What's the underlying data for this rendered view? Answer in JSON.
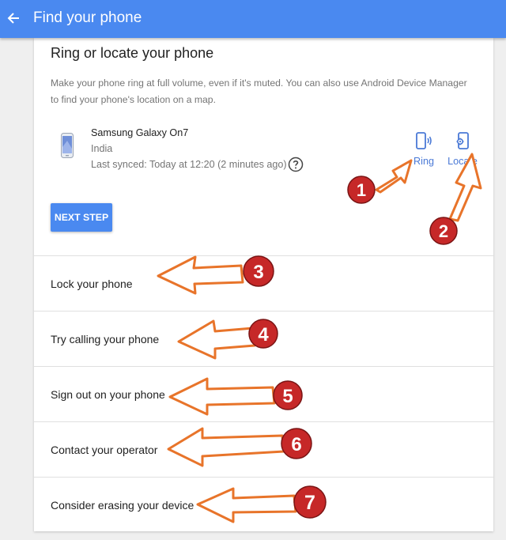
{
  "header": {
    "title": "Find your phone"
  },
  "card": {
    "title": "Ring or locate your phone",
    "description": "Make your phone ring at full volume, even if it's muted. You can also use Android Device Manager to find your phone's location on a map.",
    "device": {
      "name": "Samsung Galaxy On7",
      "country": "India",
      "last_synced": "Last synced: Today at 12:20 (2 minutes ago)"
    },
    "actions": {
      "ring_label": "Ring",
      "locate_label": "Locate"
    },
    "next_step_label": "NEXT STEP"
  },
  "rows": [
    "Lock your phone",
    "Try calling your phone",
    "Sign out on your phone",
    "Contact your operator",
    "Consider erasing your device"
  ],
  "annotations": {
    "numbers": [
      "1",
      "2",
      "3",
      "4",
      "5",
      "6",
      "7"
    ]
  },
  "colors": {
    "primary": "#4a89f0",
    "link": "#4a79d6",
    "arrow_fill": "#ffffff",
    "arrow_stroke": "#e8742a",
    "badge": "#c62828"
  },
  "icons": {
    "back": "arrow-left-icon",
    "device": "phone-thumbnail-icon",
    "help": "question-circle-icon",
    "ring": "phone-ring-icon",
    "locate": "phone-locate-icon"
  }
}
